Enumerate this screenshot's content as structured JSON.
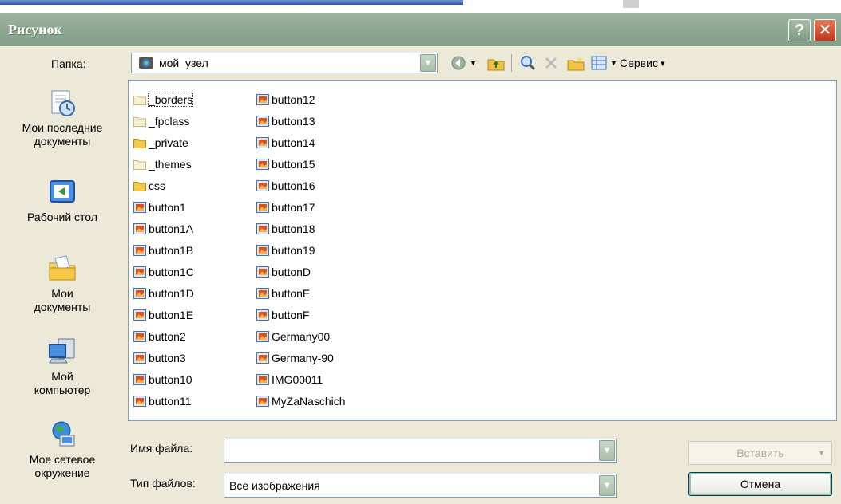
{
  "window": {
    "title": "Рисунок"
  },
  "folder": {
    "label": "Папка:",
    "value": "мой_узел"
  },
  "toolbar": {
    "tools_label": "Сервис",
    "tools_arrow": "▾"
  },
  "places": [
    {
      "label": "Мои последние документы",
      "icon": "recent-documents-icon"
    },
    {
      "label": "Рабочий стол",
      "icon": "desktop-icon"
    },
    {
      "label": "Мои документы",
      "icon": "my-documents-icon"
    },
    {
      "label": "Мой компьютер",
      "icon": "my-computer-icon"
    },
    {
      "label": "Мое сетевое окружение",
      "icon": "network-places-icon"
    }
  ],
  "files": {
    "col1": [
      {
        "name": "_borders",
        "type": "folder-web",
        "selected": true
      },
      {
        "name": "_fpclass",
        "type": "folder-web"
      },
      {
        "name": "_private",
        "type": "folder"
      },
      {
        "name": "_themes",
        "type": "folder-web"
      },
      {
        "name": "css",
        "type": "folder"
      },
      {
        "name": "button1",
        "type": "image"
      },
      {
        "name": "button1A",
        "type": "image"
      },
      {
        "name": "button1B",
        "type": "image"
      },
      {
        "name": "button1C",
        "type": "image"
      },
      {
        "name": "button1D",
        "type": "image"
      },
      {
        "name": "button1E",
        "type": "image"
      },
      {
        "name": "button2",
        "type": "image"
      },
      {
        "name": "button3",
        "type": "image"
      },
      {
        "name": "button10",
        "type": "image"
      },
      {
        "name": "button11",
        "type": "image"
      }
    ],
    "col2": [
      {
        "name": "button12",
        "type": "image"
      },
      {
        "name": "button13",
        "type": "image"
      },
      {
        "name": "button14",
        "type": "image"
      },
      {
        "name": "button15",
        "type": "image"
      },
      {
        "name": "button16",
        "type": "image"
      },
      {
        "name": "button17",
        "type": "image"
      },
      {
        "name": "button18",
        "type": "image"
      },
      {
        "name": "button19",
        "type": "image"
      },
      {
        "name": "buttonD",
        "type": "image"
      },
      {
        "name": "buttonE",
        "type": "image"
      },
      {
        "name": "buttonF",
        "type": "image"
      },
      {
        "name": "Germany00",
        "type": "image"
      },
      {
        "name": "Germany-90",
        "type": "image"
      },
      {
        "name": "IMG00011",
        "type": "image"
      },
      {
        "name": "MyZaNaschich",
        "type": "image"
      }
    ]
  },
  "filename": {
    "label": "Имя файла:",
    "value": ""
  },
  "filetype": {
    "label": "Тип файлов:",
    "value": "Все изображения"
  },
  "buttons": {
    "insert": "Вставить",
    "cancel": "Отмена"
  },
  "colors": {
    "titlebar": "#8ea893",
    "close": "#c3361a",
    "border": "#7f9db9"
  }
}
